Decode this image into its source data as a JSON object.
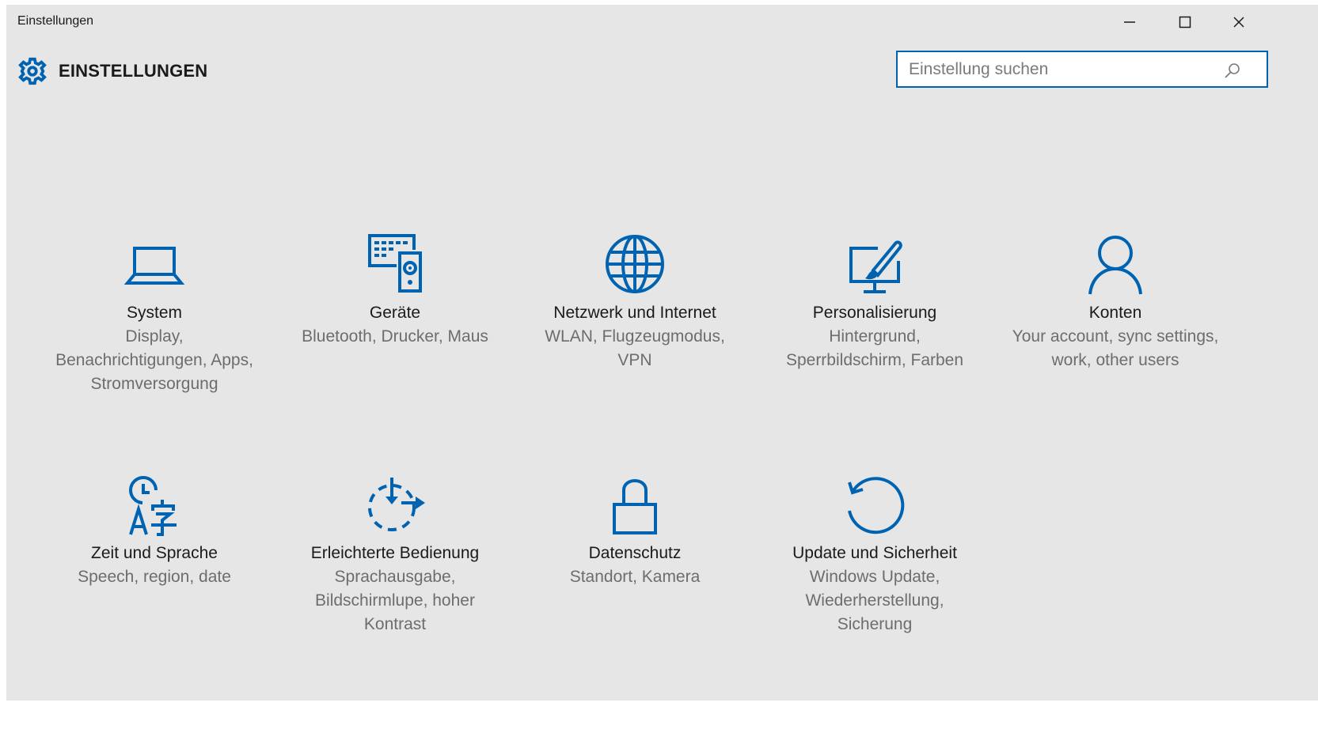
{
  "window": {
    "title": "Einstellungen"
  },
  "header": {
    "heading": "EINSTELLUNGEN",
    "icon": "gear-icon"
  },
  "search": {
    "placeholder": "Einstellung suchen",
    "value": "",
    "icon": "search-icon"
  },
  "colors": {
    "accent": "#0063b1",
    "background": "#e6e6e6",
    "label": "#1a1a1a",
    "description": "#6d6d6d"
  },
  "categories": [
    {
      "label": "System",
      "description": "Display, Benachrichtigungen, Apps, Stromversorgung",
      "icon": "laptop-icon"
    },
    {
      "label": "Geräte",
      "description": "Bluetooth, Drucker, Maus",
      "icon": "devices-icon"
    },
    {
      "label": "Netzwerk und Internet",
      "description": "WLAN, Flugzeugmodus, VPN",
      "icon": "globe-icon"
    },
    {
      "label": "Personalisierung",
      "description": "Hintergrund, Sperrbildschirm, Farben",
      "icon": "personalization-icon"
    },
    {
      "label": "Konten",
      "description": "Your account, sync settings, work, other users",
      "icon": "person-icon"
    },
    {
      "label": "Zeit und Sprache",
      "description": "Speech, region, date",
      "icon": "time-language-icon"
    },
    {
      "label": "Erleichterte Bedienung",
      "description": "Sprachausgabe, Bildschirmlupe, hoher Kontrast",
      "icon": "ease-of-access-icon"
    },
    {
      "label": "Datenschutz",
      "description": "Standort, Kamera",
      "icon": "lock-icon"
    },
    {
      "label": "Update und Sicherheit",
      "description": "Windows Update, Wiederherstellung, Sicherung",
      "icon": "update-icon"
    }
  ]
}
